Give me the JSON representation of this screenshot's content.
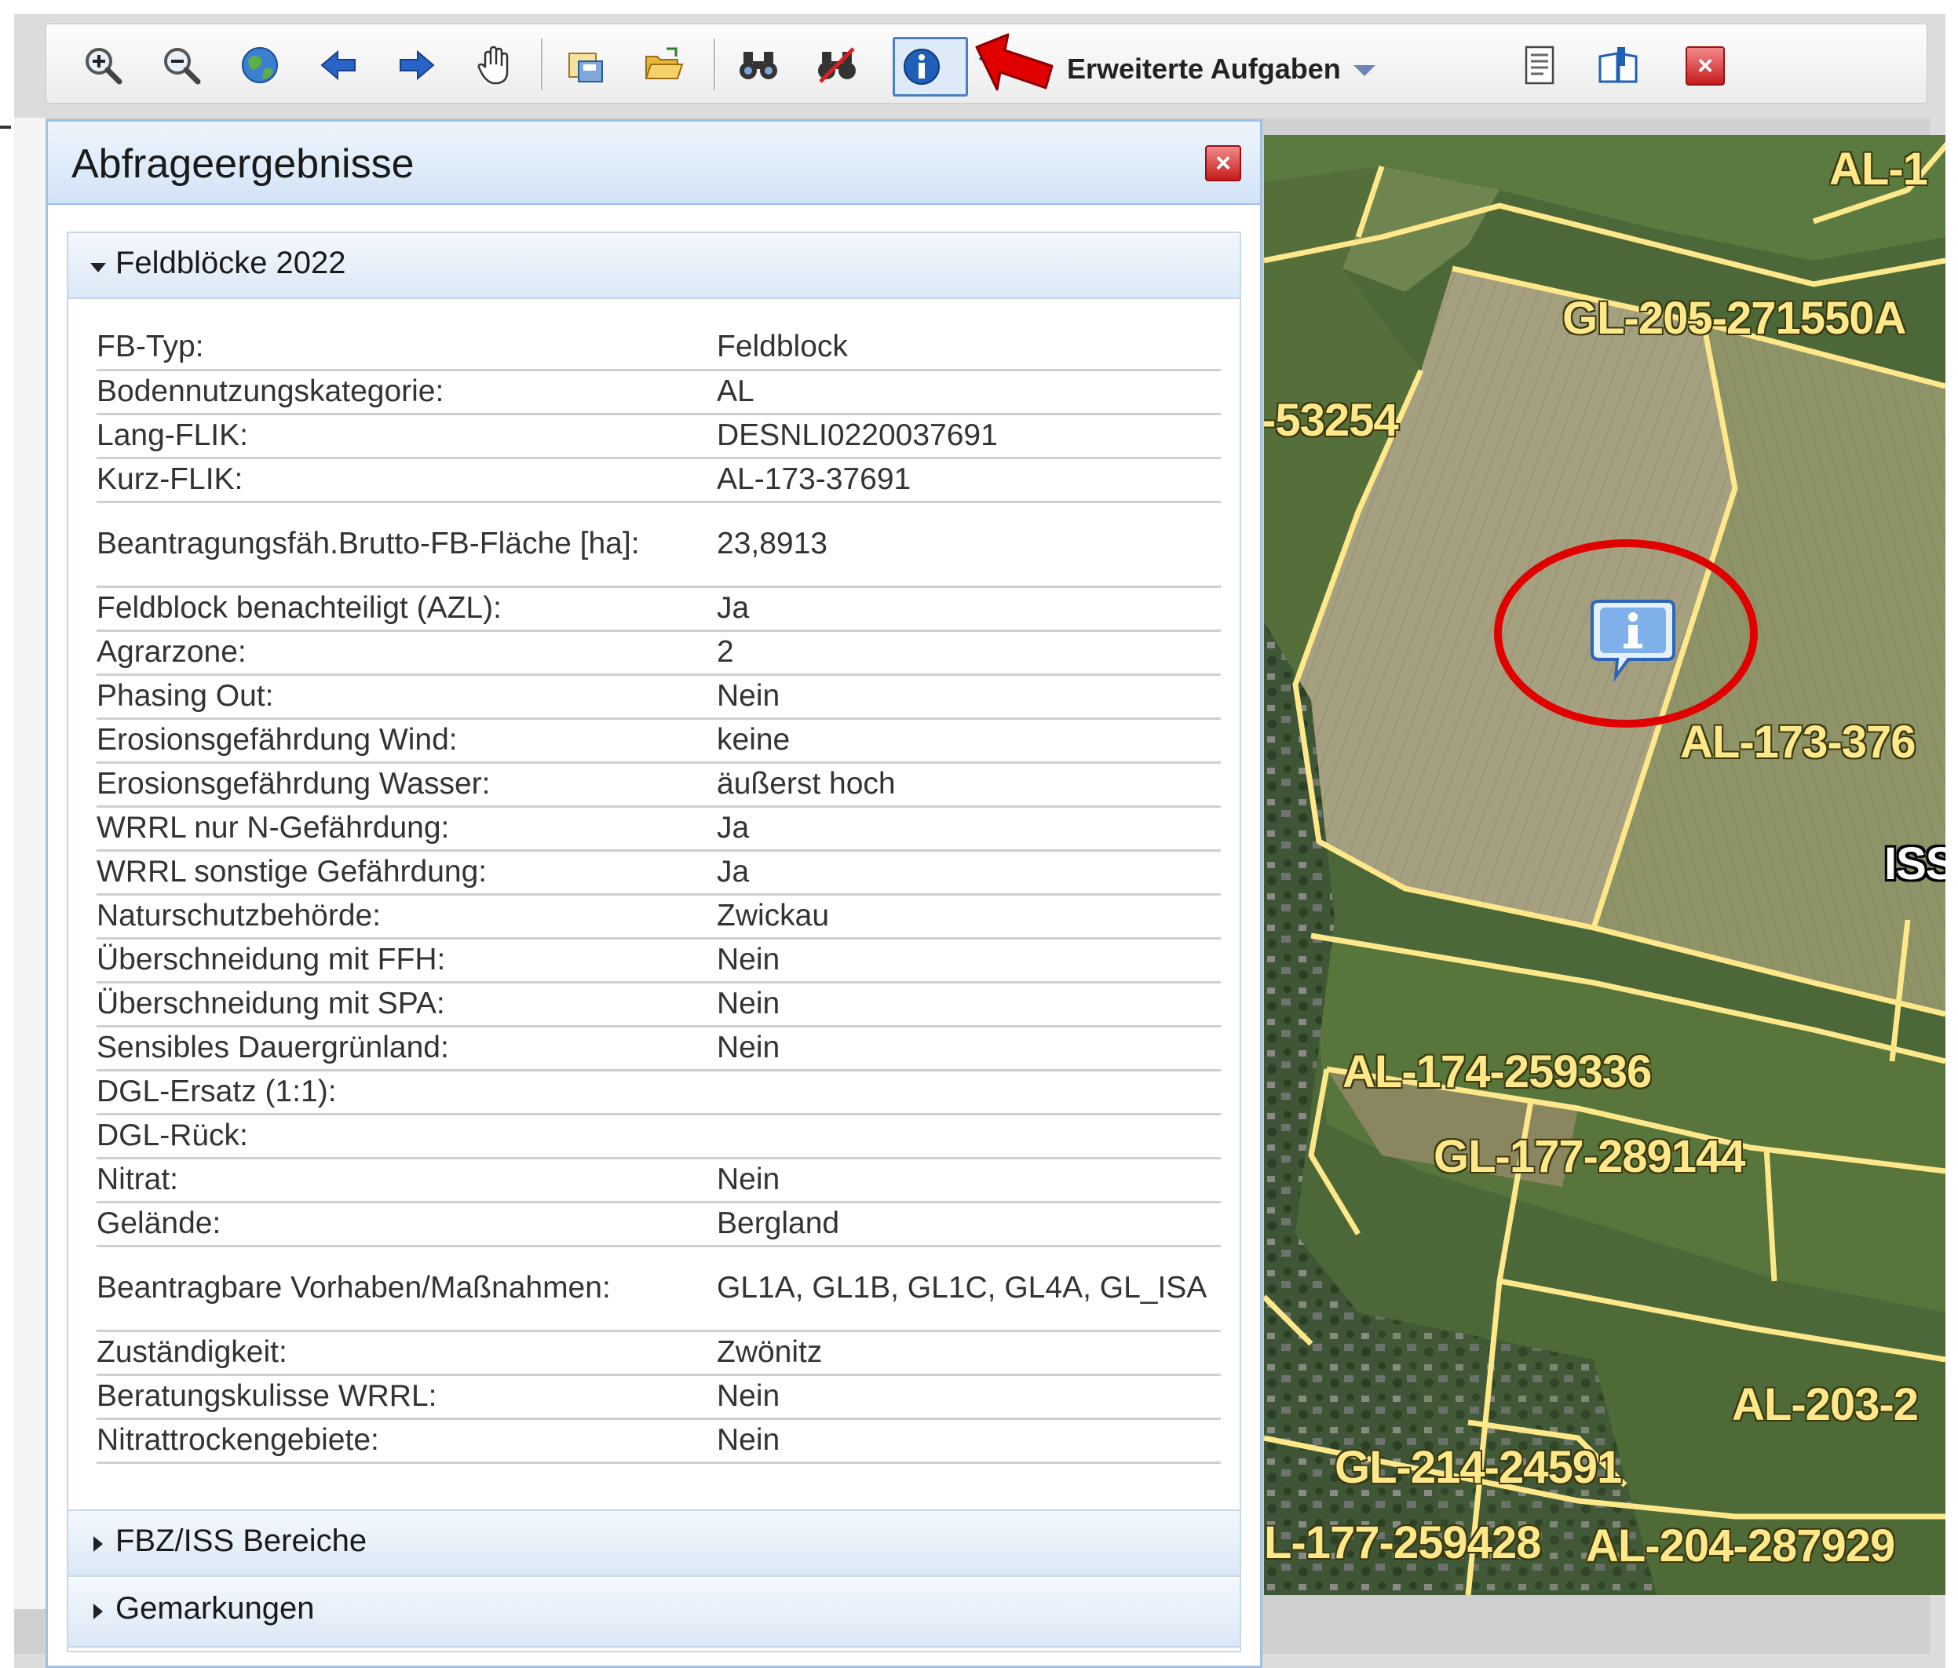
{
  "toolbar": {
    "icons": [
      "zoom-in-icon",
      "zoom-out-icon",
      "globe-icon",
      "back-arrow-icon",
      "forward-arrow-icon",
      "pan-hand-icon",
      "save-map-icon",
      "open-folder-icon",
      "binoculars-icon",
      "clear-selection-icon",
      "info-icon",
      "measure-icon",
      "document-icon",
      "bookmark-icon",
      "close-icon"
    ],
    "extended_tasks_label": "Erweiterte Aufgaben"
  },
  "panel": {
    "title": "Abfrageergebnisse",
    "sections": [
      {
        "label": "Feldblöcke 2022",
        "expanded": true
      },
      {
        "label": "FBZ/ISS Bereiche",
        "expanded": false
      },
      {
        "label": "Gemarkungen",
        "expanded": false
      }
    ],
    "attributes": [
      {
        "key": "FB-Typ:",
        "value": "Feldblock"
      },
      {
        "key": "Bodennutzungskategorie:",
        "value": "AL"
      },
      {
        "key": "Lang-FLIK:",
        "value": "DESNLI0220037691"
      },
      {
        "key": "Kurz-FLIK:",
        "value": "AL-173-37691"
      },
      {
        "key": "Beantragungsfäh.Brutto-FB-Fläche [ha]:",
        "value": "23,8913"
      },
      {
        "key": "Feldblock benachteiligt (AZL):",
        "value": "Ja"
      },
      {
        "key": "Agrarzone:",
        "value": "2"
      },
      {
        "key": "Phasing Out:",
        "value": "Nein"
      },
      {
        "key": "Erosionsgefährdung Wind:",
        "value": "keine"
      },
      {
        "key": "Erosionsgefährdung Wasser:",
        "value": "äußerst hoch"
      },
      {
        "key": "WRRL nur N-Gefährdung:",
        "value": "Ja"
      },
      {
        "key": "WRRL sonstige Gefährdung:",
        "value": "Ja"
      },
      {
        "key": "Naturschutzbehörde:",
        "value": "Zwickau"
      },
      {
        "key": "Überschneidung mit FFH:",
        "value": "Nein"
      },
      {
        "key": "Überschneidung mit SPA:",
        "value": "Nein"
      },
      {
        "key": "Sensibles Dauergrünland:",
        "value": "Nein"
      },
      {
        "key": "DGL-Ersatz (1:1):",
        "value": ""
      },
      {
        "key": "DGL-Rück:",
        "value": ""
      },
      {
        "key": "Nitrat:",
        "value": "Nein"
      },
      {
        "key": "Gelände:",
        "value": "Bergland"
      },
      {
        "key": "Beantragbare Vorhaben/Maßnahmen:",
        "value": "GL1A, GL1B, GL1C, GL4A, GL_ISA"
      },
      {
        "key": "Zuständigkeit:",
        "value": "Zwönitz"
      },
      {
        "key": "Beratungskulisse WRRL:",
        "value": "Nein"
      },
      {
        "key": "Nitrattrockengebiete:",
        "value": "Nein"
      }
    ]
  },
  "map": {
    "labels": [
      {
        "id": "al-top",
        "text": "AL-1"
      },
      {
        "id": "gl-205",
        "text": "GL-205-271550A"
      },
      {
        "id": "l-53254",
        "text": "-53254"
      },
      {
        "id": "al-173",
        "text": "AL-173-376"
      },
      {
        "id": "iss",
        "text": "ISS"
      },
      {
        "id": "al-174",
        "text": "AL-174-259336"
      },
      {
        "id": "gl-177",
        "text": "GL-177-289144"
      },
      {
        "id": "al-203",
        "text": "AL-203-2"
      },
      {
        "id": "gl-214",
        "text": "GL-214-24591"
      },
      {
        "id": "l-177",
        "text": "L-177-259428"
      },
      {
        "id": "al-204",
        "text": "AL-204-287929"
      }
    ],
    "marker_icon": "info-bubble-icon",
    "highlight_color": "#e00000",
    "boundary_color": "#ffe88a"
  },
  "colors": {
    "panel_border": "#9ec1e8",
    "annotation_red": "#e00000"
  }
}
